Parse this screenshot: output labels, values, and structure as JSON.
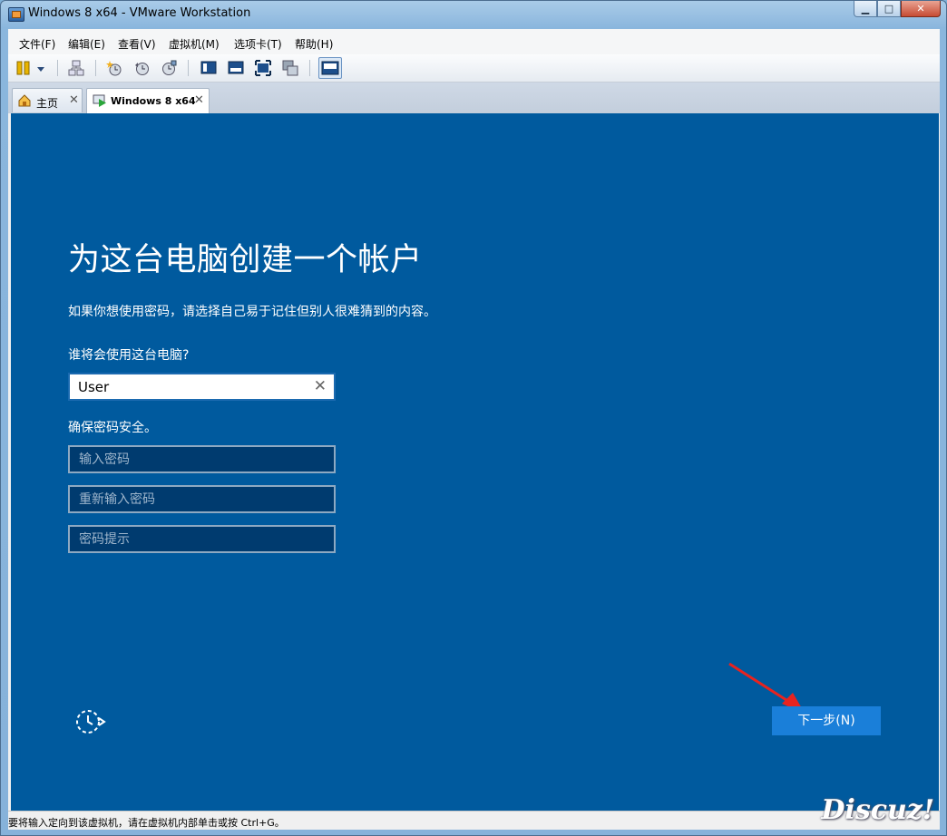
{
  "window": {
    "title": "Windows 8 x64 - VMware Workstation",
    "controls": {
      "minimize": "▁",
      "maximize": "□",
      "close": "✕"
    }
  },
  "menubar": {
    "items": [
      "文件(F)",
      "编辑(E)",
      "查看(V)",
      "虚拟机(M)",
      "选项卡(T)",
      "帮助(H)"
    ]
  },
  "toolbar": {
    "icons": [
      "pause-icon",
      "dropdown-icon",
      "network-icon",
      "snapshot-icon",
      "revert-snapshot-icon",
      "snapshot-manager-icon",
      "console-view-icon",
      "fullscreen-view-icon",
      "stretch-icon",
      "unity-icon",
      "library-icon"
    ]
  },
  "tabs": [
    {
      "label": "主页",
      "close": "✕"
    },
    {
      "label": "Windows 8 x64",
      "close": "✕"
    }
  ],
  "vm_screen": {
    "heading": "为这台电脑创建一个帐户",
    "description": "如果你想使用密码，请选择自己易于记住但别人很难猜到的内容。",
    "who_label": "谁将会使用这台电脑?",
    "username_value": "User",
    "clear_glyph": "✕",
    "security_label": "确保密码安全。",
    "password_placeholder": "输入密码",
    "reenter_placeholder": "重新输入密码",
    "hint_placeholder": "密码提示",
    "next_button": "下一步(N)"
  },
  "statusbar": {
    "text": "要将输入定向到该虚拟机，请在虚拟机内部单击或按 Ctrl+G。"
  },
  "watermark": "Discuz!",
  "colors": {
    "vm_background": "#005a9e",
    "next_button": "#1a7fd9",
    "field_dark": "#003b6f"
  }
}
